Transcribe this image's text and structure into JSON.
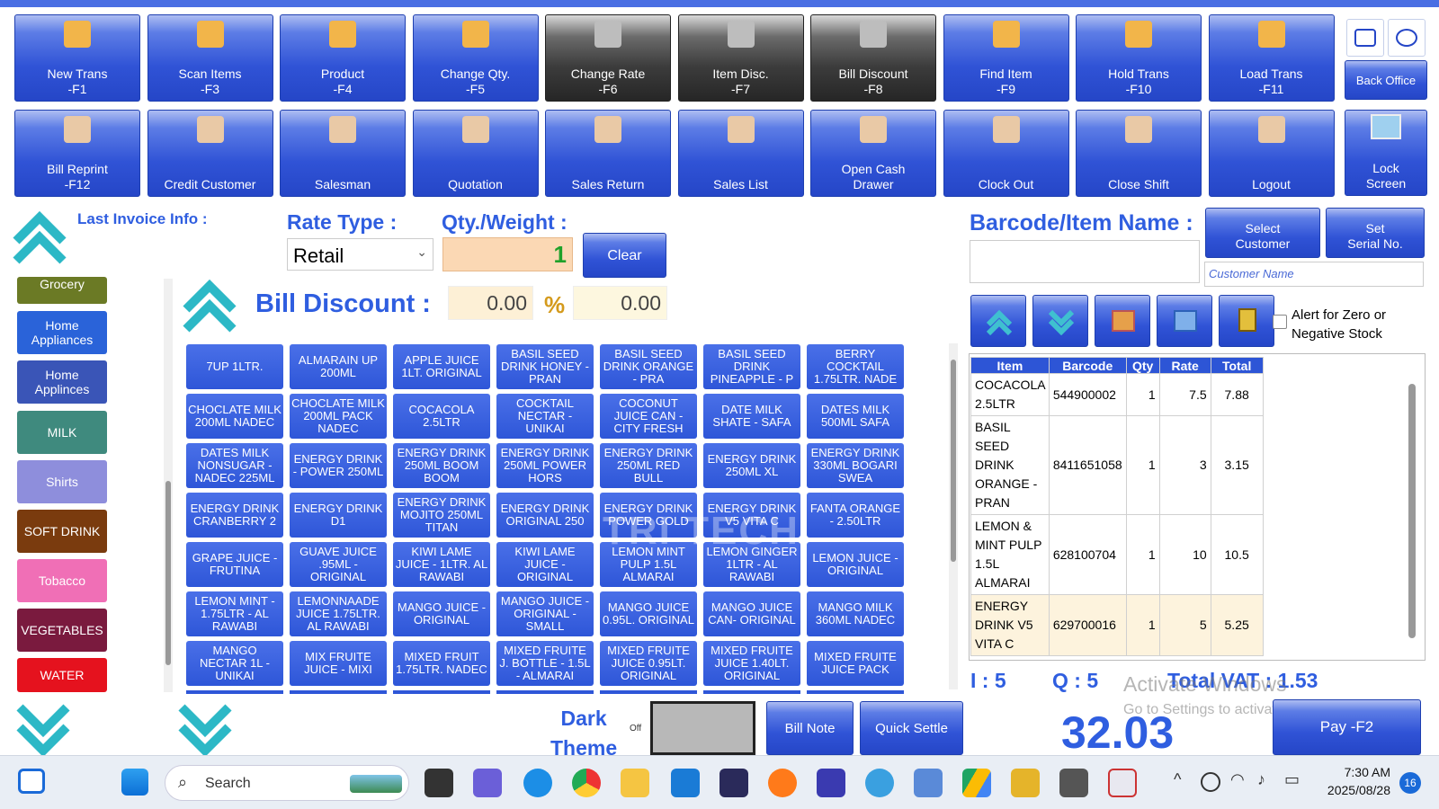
{
  "function_buttons_row1": [
    {
      "label": "New Trans",
      "key": "-F1",
      "style": "blue",
      "icon": "new-trans-icon"
    },
    {
      "label": "Scan Items",
      "key": "-F3",
      "style": "blue",
      "icon": "barcode-icon"
    },
    {
      "label": "Product",
      "key": "-F4",
      "style": "blue",
      "icon": "box-icon"
    },
    {
      "label": "Change Qty.",
      "key": "-F5",
      "style": "blue",
      "icon": "cart-icon"
    },
    {
      "label": "Change Rate",
      "key": "-F6",
      "style": "dark",
      "icon": "gears-icon"
    },
    {
      "label": "Item Disc.",
      "key": "-F7",
      "style": "dark",
      "icon": "gift-icon"
    },
    {
      "label": "Bill Discount",
      "key": "-F8",
      "style": "dark",
      "icon": "tag-icon"
    },
    {
      "label": "Find Item",
      "key": "-F9",
      "style": "blue",
      "icon": "magnifier-icon"
    },
    {
      "label": "Hold Trans",
      "key": "-F10",
      "style": "blue",
      "icon": "clipboard-icon"
    },
    {
      "label": "Load Trans",
      "key": "-F11",
      "style": "blue",
      "icon": "computer-icon"
    }
  ],
  "function_buttons_row2": [
    {
      "label": "Bill Reprint",
      "key": "-F12",
      "icon": "printer-icon"
    },
    {
      "label": "Credit Customer",
      "key": "",
      "icon": "people-icon"
    },
    {
      "label": "Salesman",
      "key": "",
      "icon": "salesman-icon"
    },
    {
      "label": "Quotation",
      "key": "",
      "icon": "quotation-icon"
    },
    {
      "label": "Sales Return",
      "key": "",
      "icon": "return-chart-icon"
    },
    {
      "label": "Sales List",
      "key": "",
      "icon": "sales-list-icon"
    },
    {
      "label": "Open Cash",
      "key": "Drawer",
      "icon": "cash-drawer-icon"
    },
    {
      "label": "Clock Out",
      "key": "",
      "icon": "clock-icon"
    },
    {
      "label": "Close Shift",
      "key": "",
      "icon": "calculator-icon"
    },
    {
      "label": "Logout",
      "key": "",
      "icon": "logout-icon"
    }
  ],
  "right_buttons": {
    "back_office": "Back Office",
    "lock_screen_line1": "Lock",
    "lock_screen_line2": "Screen"
  },
  "last_invoice_info": "Last Invoice Info :",
  "rate_type": {
    "label": "Rate Type :",
    "value": "Retail"
  },
  "qty_weight": {
    "label": "Qty./Weight :",
    "value": "1"
  },
  "clear_label": "Clear",
  "bill_discount": {
    "label": "Bill Discount :",
    "percent": "0.00",
    "percent_sign": "%",
    "amount": "0.00"
  },
  "barcode": {
    "label": "Barcode/Item Name :",
    "select_customer_1": "Select",
    "select_customer_2": "Customer",
    "serial_1": "Set",
    "serial_2": "Serial No.",
    "customer_placeholder": "Customer Name"
  },
  "alert_zero_stock": {
    "line1": "Alert for Zero or",
    "line2": "Negative Stock"
  },
  "categories": [
    {
      "label": "Grocery",
      "color": "#6b7a25"
    },
    {
      "label": "Home Appliances",
      "color": "#2a63d9"
    },
    {
      "label": "Home Applinces",
      "color": "#3a55b7"
    },
    {
      "label": "MILK",
      "color": "#3f8a7e"
    },
    {
      "label": "Shirts",
      "color": "#8e8edc"
    },
    {
      "label": "SOFT DRINK",
      "color": "#7a3b0e"
    },
    {
      "label": "Tobacco",
      "color": "#f06fb6"
    },
    {
      "label": "VEGETABLES",
      "color": "#7a1a3e"
    },
    {
      "label": "WATER",
      "color": "#e5121e"
    }
  ],
  "items": [
    "7UP 1LTR.",
    "ALMARAIN UP 200ML",
    "APPLE JUICE 1LT. ORIGINAL",
    "BASIL SEED DRINK HONEY - PRAN",
    "BASIL SEED DRINK ORANGE - PRA",
    "BASIL SEED DRINK PINEAPPLE - P",
    "BERRY COCKTAIL 1.75LTR. NADE",
    "CHOCLATE MILK 200ML NADEC",
    "CHOCLATE MILK 200ML PACK NADEC",
    "COCACOLA 2.5LTR",
    "COCKTAIL NECTAR - UNIKAI",
    "COCONUT JUICE CAN - CITY FRESH",
    "DATE MILK SHATE - SAFA",
    "DATES MILK 500ML SAFA",
    "DATES MILK NONSUGAR - NADEC 225ML",
    "ENERGY DRINK - POWER 250ML",
    "ENERGY DRINK 250ML BOOM BOOM",
    "ENERGY DRINK 250ML POWER HORS",
    "ENERGY DRINK 250ML RED BULL",
    "ENERGY DRINK 250ML XL",
    "ENERGY DRINK 330ML BOGARI SWEA",
    "ENERGY DRINK CRANBERRY 2",
    "ENERGY DRINK D1",
    "ENERGY DRINK MOJITO 250ML TITAN",
    "ENERGY DRINK ORIGINAL 250",
    "ENERGY DRINK POWER GOLD",
    "ENERGY DRINK V5 VITA C",
    "FANTA ORANGE - 2.50LTR",
    "GRAPE JUICE - FRUTINA",
    "GUAVE JUICE .95ML - ORIGINAL",
    "KIWI LAME JUICE - 1LTR. AL RAWABI",
    "KIWI LAME JUICE - ORIGINAL",
    "LEMON MINT PULP 1.5L ALMARAI",
    "LEMON GINGER 1LTR - AL RAWABI",
    "LEMON JUICE - ORIGINAL",
    "LEMON MINT - 1.75LTR - AL RAWABI",
    "LEMONNAADE JUICE 1.75LTR. AL RAWABI",
    "MANGO JUICE - ORIGINAL",
    "MANGO JUICE - ORIGINAL - SMALL",
    "MANGO JUICE 0.95L. ORIGINAL",
    "MANGO JUICE CAN- ORIGINAL",
    "MANGO MILK 360ML NADEC",
    "MANGO NECTAR 1L - UNIKAI",
    "MIX FRUITE JUICE - MIXI",
    "MIXED FRUIT 1.75LTR. NADEC",
    "MIXED FRUITE J. BOTTLE - 1.5L - ALMARAI",
    "MIXED FRUITE JUICE 0.95LT. ORIGINAL",
    "MIXED FRUITE JUICE 1.40LT. ORIGINAL",
    "MIXED FRUITE JUICE PACK"
  ],
  "cart": {
    "headers": [
      "Item",
      "Barcode",
      "Qty",
      "Rate",
      "Total"
    ],
    "rows": [
      {
        "item": "COCACOLA 2.5LTR",
        "barcode": "544900002",
        "qty": "1",
        "rate": "7.5",
        "total": "7.88"
      },
      {
        "item": "BASIL SEED DRINK ORANGE - PRAN",
        "barcode": "8411651058",
        "qty": "1",
        "rate": "3",
        "total": "3.15"
      },
      {
        "item": "LEMON & MINT PULP 1.5L ALMARAI",
        "barcode": "628100704",
        "qty": "1",
        "rate": "10",
        "total": "10.5"
      },
      {
        "item": "ENERGY DRINK V5 VITA C",
        "barcode": "629700016",
        "qty": "1",
        "rate": "5",
        "total": "5.25"
      }
    ]
  },
  "summary": {
    "items": "I : 5",
    "qty": "Q : 5",
    "vat": "Total VAT : 1.53",
    "total": "32.03"
  },
  "dark_theme": {
    "line1": "Dark",
    "line2": "Theme",
    "toggle_state": "Off"
  },
  "bottom_buttons": {
    "bill_note": "Bill Note",
    "quick_settle": "Quick Settle",
    "pay": "Pay -F2"
  },
  "watermark": {
    "line1": "Activate Windows",
    "line2": "Go to Settings to activate Windows."
  },
  "taskbar": {
    "search": "Search",
    "time": "7:30 AM",
    "date": "2025/08/28",
    "badge": "16"
  }
}
